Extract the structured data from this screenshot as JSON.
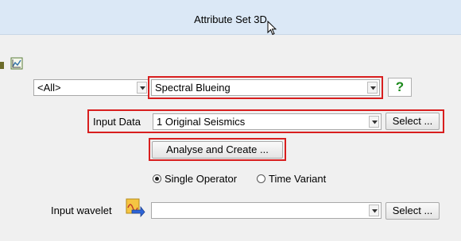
{
  "window": {
    "title": "Attribute Set 3D"
  },
  "icons": {
    "toolbar_stub": "toolbar-partial-icon",
    "toolbar": "chart-icon",
    "help": "help-question-icon",
    "wavelet": "wavelet-import-icon",
    "cursor": "mouse-cursor-icon"
  },
  "attribute": {
    "group_value": "<All>",
    "type_value": "Spectral Blueing",
    "help_label": "?"
  },
  "input_data": {
    "label": "Input Data",
    "value": "1 Original Seismics",
    "select_label": "Select ..."
  },
  "analyse_button": "Analyse and Create ...",
  "operator": {
    "options": [
      {
        "label": "Single Operator",
        "selected": true
      },
      {
        "label": "Time Variant",
        "selected": false
      }
    ]
  },
  "wavelet": {
    "label": "Input wavelet",
    "value": "",
    "select_label": "Select ..."
  },
  "colors": {
    "highlight": "#d81e1e",
    "titlebar": "#dbe8f6",
    "help": "#1d8a1d"
  }
}
